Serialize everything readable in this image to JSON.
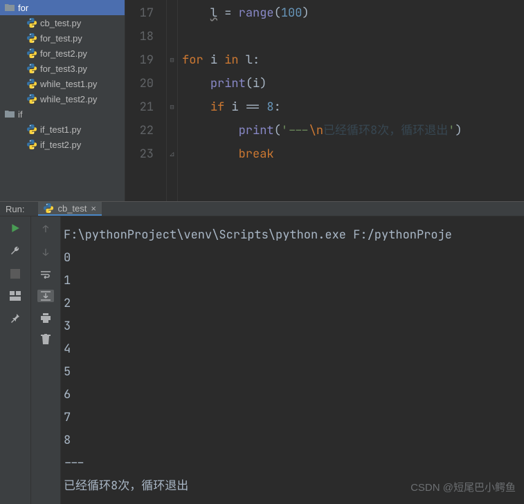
{
  "sidebar": {
    "folders": [
      {
        "name": "for",
        "selected": true
      },
      {
        "name": "if",
        "selected": false
      }
    ],
    "files_for": [
      "cb_test.py",
      "for_test.py",
      "for_test2.py",
      "for_test3.py",
      "while_test1.py",
      "while_test2.py"
    ],
    "files_if": [
      "if_test1.py",
      "if_test2.py"
    ]
  },
  "editor": {
    "first_line_no": 17,
    "lines": [
      {
        "no": 17,
        "tokens": [
          {
            "t": "    ",
            "c": "ident"
          },
          {
            "t": "l",
            "c": "underline-wave ident"
          },
          {
            "t": " = ",
            "c": "ident"
          },
          {
            "t": "range",
            "c": "fn"
          },
          {
            "t": "(",
            "c": "ident"
          },
          {
            "t": "100",
            "c": "num"
          },
          {
            "t": ")",
            "c": "ident"
          }
        ]
      },
      {
        "no": 18,
        "tokens": []
      },
      {
        "no": 19,
        "tokens": [
          {
            "t": "for ",
            "c": "kw"
          },
          {
            "t": "i ",
            "c": "ident"
          },
          {
            "t": "in ",
            "c": "kw"
          },
          {
            "t": "l:",
            "c": "ident"
          }
        ]
      },
      {
        "no": 20,
        "tokens": [
          {
            "t": "    ",
            "c": "ident"
          },
          {
            "t": "print",
            "c": "fn"
          },
          {
            "t": "(i)",
            "c": "ident"
          }
        ]
      },
      {
        "no": 21,
        "tokens": [
          {
            "t": "    ",
            "c": "ident"
          },
          {
            "t": "if ",
            "c": "kw"
          },
          {
            "t": "i == ",
            "c": "ident"
          },
          {
            "t": "8",
            "c": "num"
          },
          {
            "t": ":",
            "c": "ident"
          }
        ]
      },
      {
        "no": 22,
        "tokens": [
          {
            "t": "        ",
            "c": "ident"
          },
          {
            "t": "print",
            "c": "fn"
          },
          {
            "t": "(",
            "c": "ident"
          },
          {
            "t": "'---",
            "c": "str"
          },
          {
            "t": "\\n",
            "c": "esc"
          },
          {
            "t": "已经循环8次，循环退出",
            "c": "cjk"
          },
          {
            "t": "'",
            "c": "str"
          },
          {
            "t": ")",
            "c": "ident"
          }
        ]
      },
      {
        "no": 23,
        "tokens": [
          {
            "t": "        ",
            "c": "ident"
          },
          {
            "t": "break",
            "c": "kw"
          }
        ]
      }
    ]
  },
  "run": {
    "label": "Run:",
    "tab_name": "cb_test",
    "output_header": "F:\\pythonProject\\venv\\Scripts\\python.exe F:/pythonProje",
    "lines": [
      "0",
      "1",
      "2",
      "3",
      "4",
      "5",
      "6",
      "7",
      "8",
      "---",
      "已经循环8次，循环退出"
    ]
  },
  "watermark": "CSDN @短尾巴小鳄鱼"
}
